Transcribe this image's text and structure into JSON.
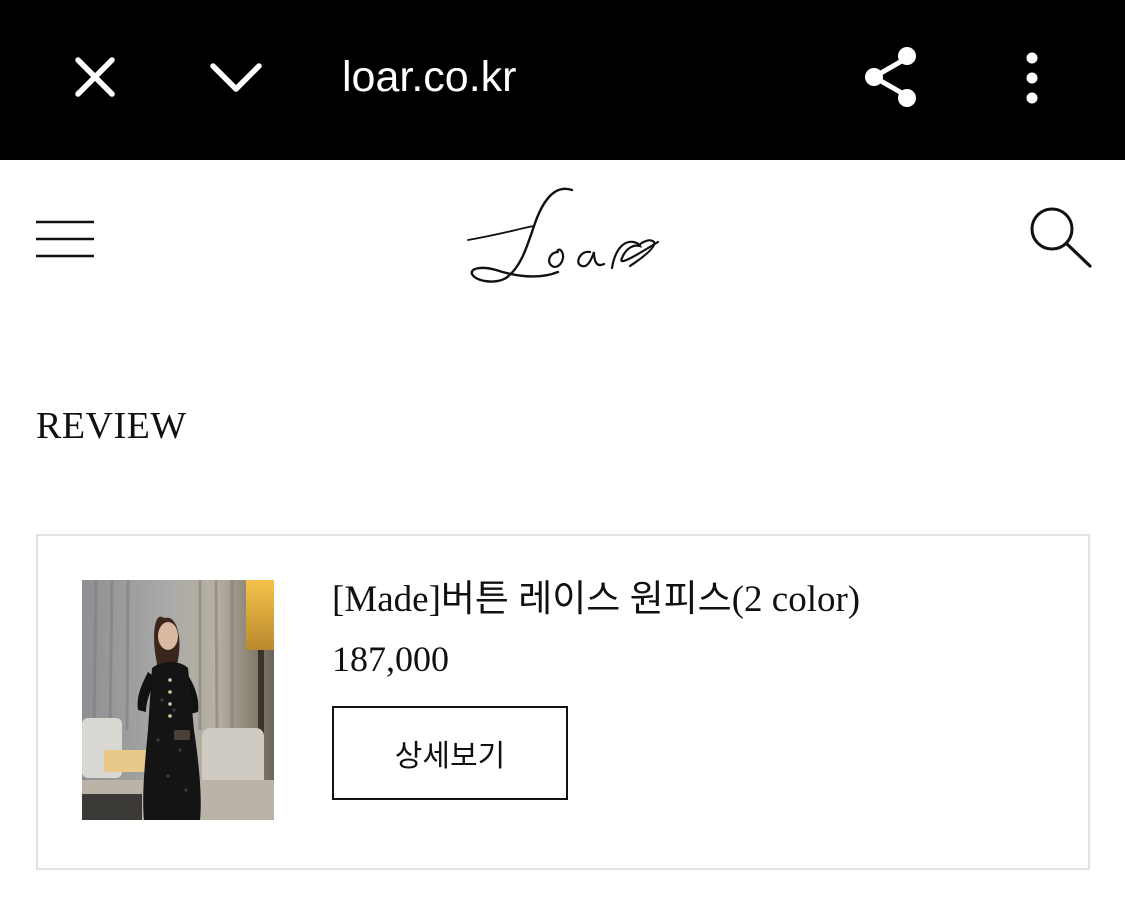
{
  "browser": {
    "url": "loar.co.kr",
    "close_icon": "close-icon",
    "collapse_icon": "chevron-down-icon",
    "share_icon": "share-icon",
    "more_icon": "more-vertical-icon"
  },
  "header": {
    "logo_text": "Loar",
    "menu_icon": "hamburger-icon",
    "search_icon": "search-icon"
  },
  "section": {
    "title": "REVIEW"
  },
  "product": {
    "name": "[Made]버튼 레이스 원피스(2 color)",
    "price": "187,000",
    "detail_label": "상세보기",
    "image": "product-thumbnail"
  },
  "colors": {
    "topbar_bg": "#000000",
    "text": "#111111",
    "card_border": "#e3e3e3"
  }
}
